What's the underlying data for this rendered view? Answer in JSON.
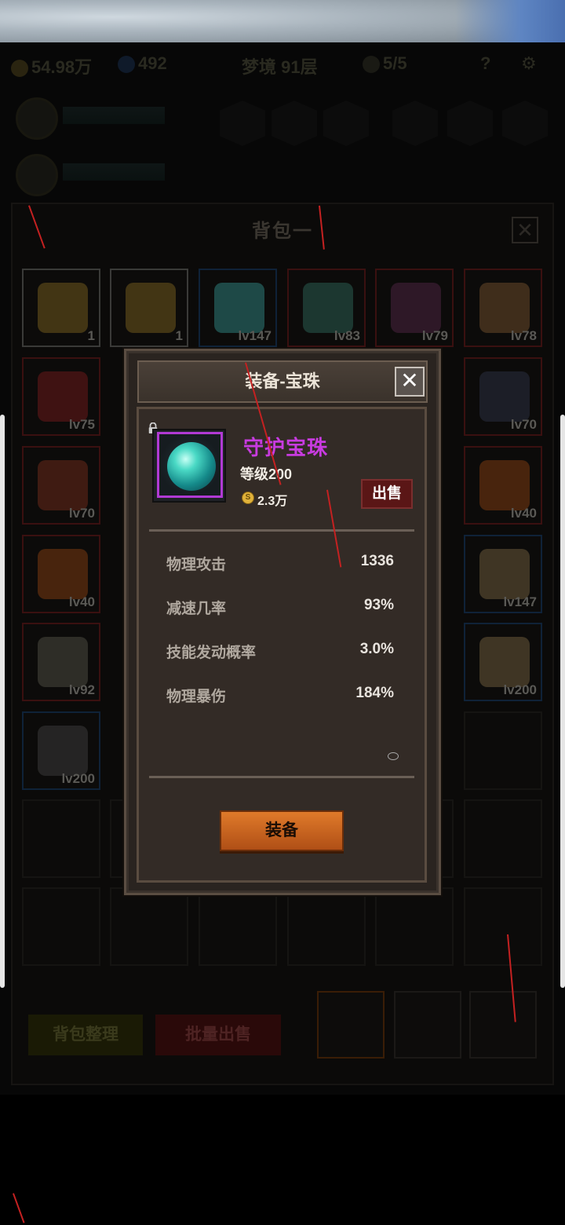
{
  "resources": {
    "gold": "54.98万",
    "gems": "492",
    "stage": "梦境 91层",
    "keys": "5/5",
    "help": "?"
  },
  "bag": {
    "title": "背包一",
    "close": "✕",
    "cells": [
      {
        "lv": "1",
        "border": "grey",
        "color": "#6f5a1e"
      },
      {
        "lv": "1",
        "border": "grey",
        "color": "#6f5a1e"
      },
      {
        "lv": "lv147",
        "border": "blue",
        "color": "#2e7d7a"
      },
      {
        "lv": "lv83",
        "border": "red",
        "color": "#2a5c50"
      },
      {
        "lv": "lv79",
        "border": "red",
        "color": "#4a2540"
      },
      {
        "lv": "lv78",
        "border": "red",
        "color": "#6a4a2a"
      },
      {
        "lv": "lv75",
        "border": "red",
        "color": "#6a1a1a"
      },
      {
        "lv": "lv70",
        "border": "red",
        "color": "#2a3040"
      },
      {
        "lv": "lv70",
        "border": "red",
        "color": "#6a2a1a"
      },
      {
        "lv": "lv40",
        "border": "red",
        "color": "#7a3a10"
      },
      {
        "lv": "lv40",
        "border": "red",
        "color": "#7a3a10"
      },
      {
        "lv": "lv147",
        "border": "blue",
        "color": "#6a5a3a"
      },
      {
        "lv": "lv92",
        "border": "red",
        "color": "#4a4a40"
      },
      {
        "lv": "lv200",
        "border": "blue",
        "color": "#6a5a3a"
      },
      {
        "lv": "lv200",
        "border": "blue",
        "color": "#3a3a3a"
      }
    ],
    "sort_label": "背包整理",
    "batch_sell_label": "批量出售"
  },
  "modal": {
    "title": "装备-宝珠",
    "close": "✕",
    "item": {
      "name": "守护宝珠",
      "level": "等级200",
      "price": "2.3万",
      "coin_symbol": "S",
      "quality_color": "#b13ad4"
    },
    "sell_label": "出售",
    "stats": [
      {
        "name": "物理攻击",
        "value": "1336"
      },
      {
        "name": "减速几率",
        "value": "93%"
      },
      {
        "name": "技能发动概率",
        "value": "3.0%"
      },
      {
        "name": "物理暴伤",
        "value": "184%"
      }
    ],
    "equip_label": "装备"
  },
  "colors": {
    "accent_orange": "#d06a22",
    "quality_purple": "#b13ad4",
    "sell_red": "#5a1616"
  }
}
